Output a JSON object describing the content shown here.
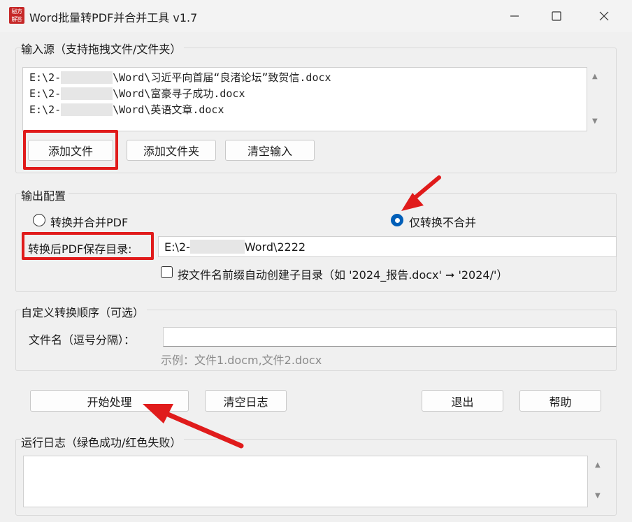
{
  "window": {
    "title": "Word批量转PDF并合并工具 v1.7",
    "icon_text": "秘方 解答",
    "controls": [
      "minimize-icon",
      "maximize-icon",
      "close-icon"
    ]
  },
  "input_source": {
    "title": "输入源（支持拖拽文件/文件夹）",
    "files": [
      {
        "prefix": "E:\\2-",
        "suffix": "\\Word\\习近平向首届“良渚论坛”致贺信.docx"
      },
      {
        "prefix": "E:\\2-",
        "suffix": "\\Word\\富豪寻子成功.docx"
      },
      {
        "prefix": "E:\\2-",
        "suffix": "\\Word\\英语文章.docx"
      }
    ],
    "buttons": {
      "add_file": "添加文件",
      "add_folder": "添加文件夹",
      "clear_input": "清空输入"
    }
  },
  "output_config": {
    "title": "输出配置",
    "radio_merge": "转换并合并PDF",
    "radio_convert_only": "仅转换不合并",
    "selected": "radio_convert_only",
    "save_dir_label": "转换后PDF保存目录:",
    "save_dir_prefix": "E:\\2-",
    "save_dir_suffix": "Word\\2222",
    "auto_subdir_label": "按文件名前缀自动创建子目录（如 '2024_报告.docx' ➞ '2024/'）",
    "auto_subdir_checked": false
  },
  "custom_order": {
    "title": "自定义转换顺序（可选）",
    "filename_label": "文件名（逗号分隔）：",
    "filename_value": "",
    "example": "示例：文件1.docm,文件2.docx"
  },
  "actions": {
    "start": "开始处理",
    "clear_log": "清空日志",
    "exit": "退出",
    "help": "帮助"
  },
  "log": {
    "title": "运行日志（绿色成功/红色失败）",
    "content": ""
  },
  "colors": {
    "annotation_red": "#e01b1b",
    "radio_selected": "#005fb8",
    "window_bg": "#f0f0f0"
  }
}
